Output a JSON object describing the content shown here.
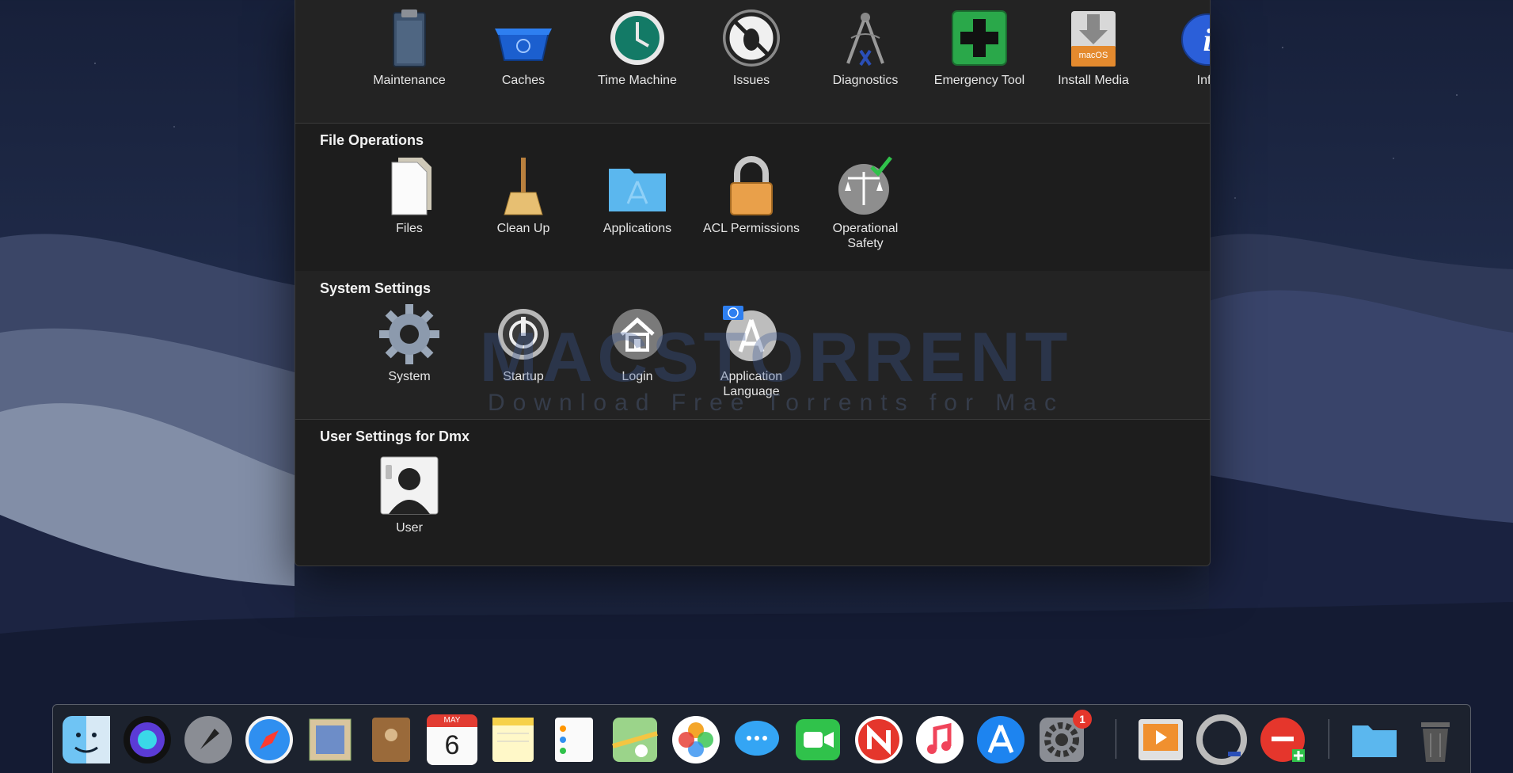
{
  "watermark": {
    "title": "MACSTORRENT",
    "tagline": "Download Free Torrents for Mac"
  },
  "sections": {
    "top": {
      "items": [
        {
          "label": "Maintenance",
          "icon": "clipboard-icon"
        },
        {
          "label": "Caches",
          "icon": "recycle-bin-icon"
        },
        {
          "label": "Time Machine",
          "icon": "time-machine-icon"
        },
        {
          "label": "Issues",
          "icon": "no-bug-icon"
        },
        {
          "label": "Diagnostics",
          "icon": "calipers-icon"
        },
        {
          "label": "Emergency Tool",
          "icon": "first-aid-cross-icon"
        },
        {
          "label": "Install Media",
          "icon": "install-drive-icon"
        },
        {
          "label": "Info",
          "icon": "info-icon"
        }
      ],
      "install_drive_text": "macOS"
    },
    "file_operations": {
      "title": "File Operations",
      "items": [
        {
          "label": "Files",
          "icon": "document-icon"
        },
        {
          "label": "Clean Up",
          "icon": "broom-icon"
        },
        {
          "label": "Applications",
          "icon": "applications-folder-icon"
        },
        {
          "label": "ACL Permissions",
          "icon": "padlock-icon"
        },
        {
          "label": "Operational Safety",
          "icon": "scales-check-icon"
        }
      ]
    },
    "system_settings": {
      "title": "System Settings",
      "items": [
        {
          "label": "System",
          "icon": "gear-icon"
        },
        {
          "label": "Startup",
          "icon": "power-icon"
        },
        {
          "label": "Login",
          "icon": "home-icon"
        },
        {
          "label": "Application Language",
          "icon": "app-language-icon"
        }
      ]
    },
    "user_settings": {
      "title": "User Settings for Dmx",
      "items": [
        {
          "label": "User",
          "icon": "user-silhouette-icon"
        }
      ]
    }
  },
  "dock": {
    "calendar_month": "MAY",
    "calendar_day": "6",
    "system_prefs_badge": "1",
    "items": [
      {
        "name": "finder"
      },
      {
        "name": "siri"
      },
      {
        "name": "launchpad"
      },
      {
        "name": "safari"
      },
      {
        "name": "mail"
      },
      {
        "name": "contacts"
      },
      {
        "name": "calendar"
      },
      {
        "name": "notes"
      },
      {
        "name": "reminders"
      },
      {
        "name": "maps"
      },
      {
        "name": "photos"
      },
      {
        "name": "messages"
      },
      {
        "name": "facetime"
      },
      {
        "name": "news"
      },
      {
        "name": "music"
      },
      {
        "name": "app-store"
      },
      {
        "name": "system-preferences"
      },
      {
        "name": "photo-slideshow"
      },
      {
        "name": "sync"
      },
      {
        "name": "toolbox"
      },
      {
        "name": "folder"
      },
      {
        "name": "trash"
      }
    ]
  },
  "colors": {
    "window_bg": "#1d1d1d",
    "section_alt_bg": "#232323",
    "text": "#e6e6e6",
    "emergency_green": "#2aa84a",
    "info_blue": "#2b5fd9",
    "folder_blue": "#5bb7ee"
  }
}
